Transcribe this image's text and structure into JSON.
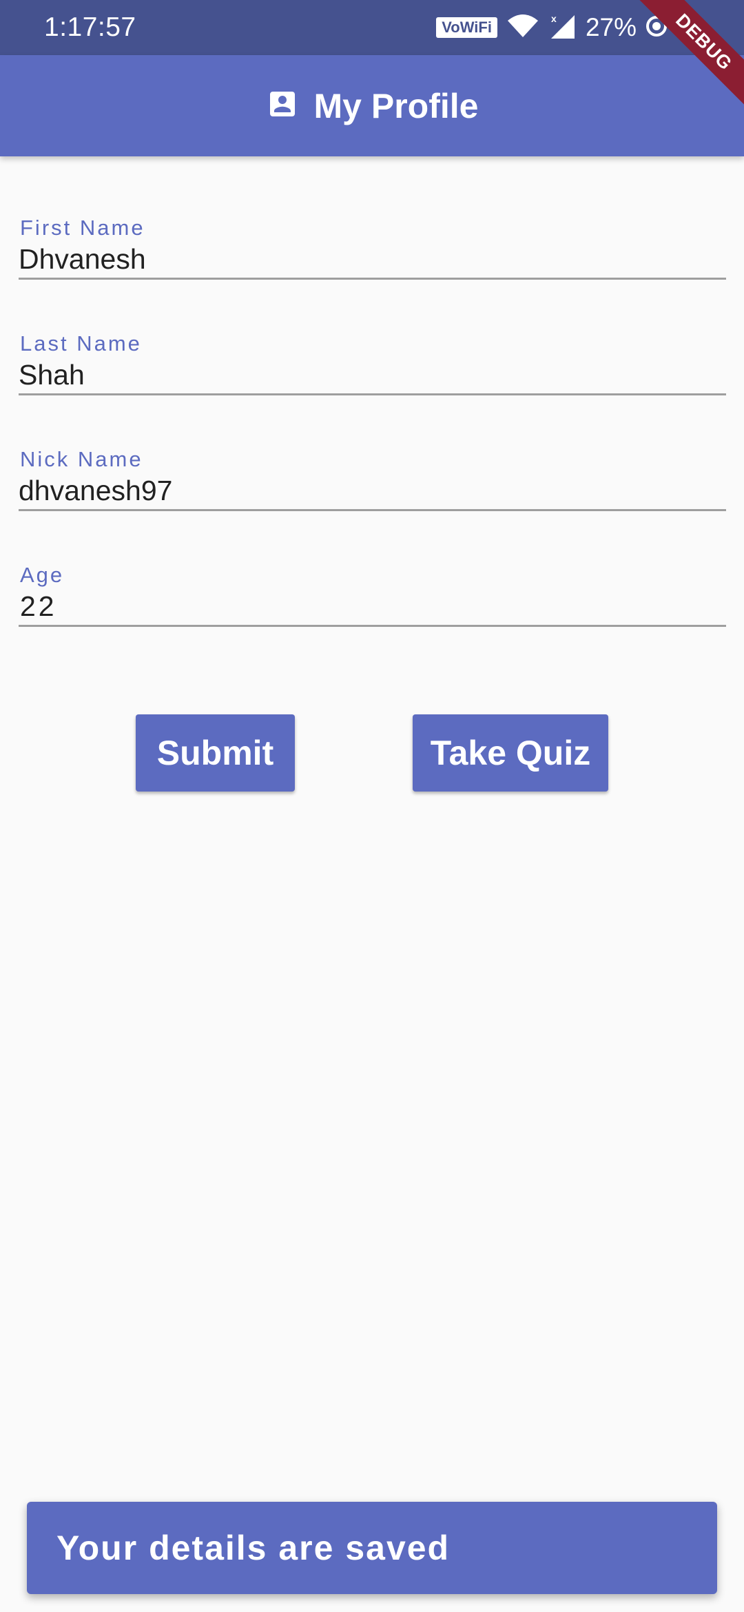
{
  "status_bar": {
    "time": "1:17:57",
    "network_badge": "VoWiFi",
    "battery_percent": "27%",
    "icons": [
      "wifi-icon",
      "signal-icon",
      "battery-icon"
    ]
  },
  "debug_banner": {
    "label": "DEBUG"
  },
  "app_bar": {
    "icon": "account-box-icon",
    "title": "My Profile"
  },
  "form": {
    "fields": [
      {
        "label": "First Name",
        "value": "Dhvanesh"
      },
      {
        "label": "Last Name",
        "value": "Shah"
      },
      {
        "label": "Nick Name",
        "value": "dhvanesh97"
      },
      {
        "label": "Age",
        "value": "22"
      }
    ]
  },
  "actions": {
    "submit_label": "Submit",
    "take_quiz_label": "Take Quiz"
  },
  "snackbar": {
    "message": "Your details are saved"
  },
  "colors": {
    "primary": "#5c6bc0",
    "status_bar": "#45528f",
    "background": "#fafafa",
    "debug_ribbon": "#8b1e32"
  }
}
